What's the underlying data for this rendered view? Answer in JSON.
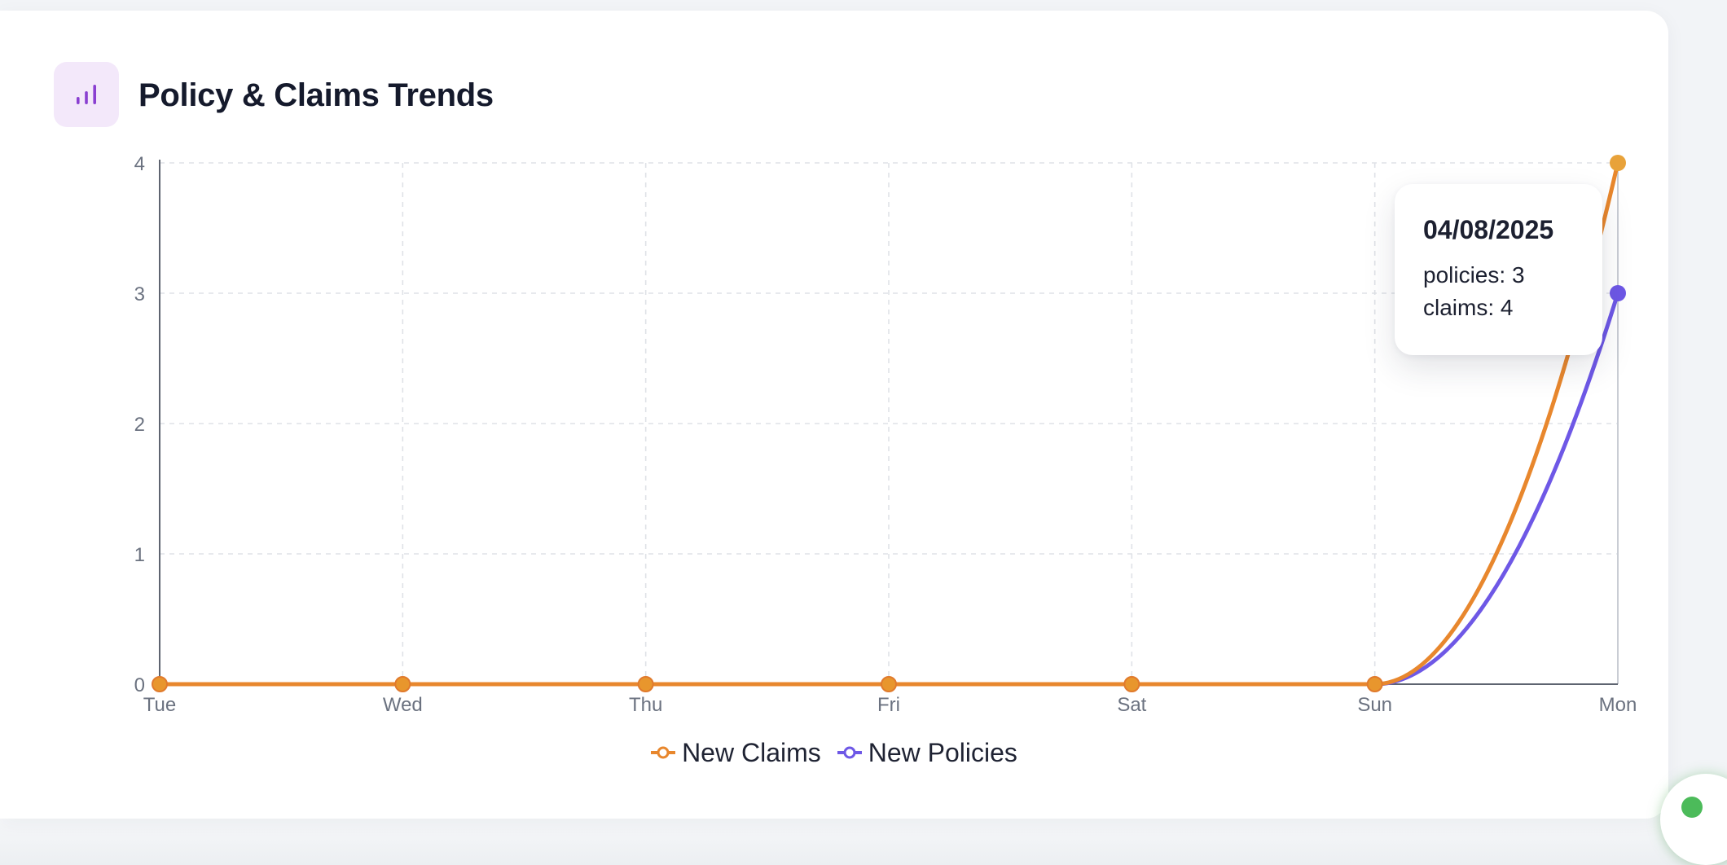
{
  "header": {
    "title": "Policy & Claims Trends",
    "icon": "bar-chart-icon",
    "icon_color": "#8a3fd1"
  },
  "chart_data": {
    "type": "line",
    "title": "Policy & Claims Trends",
    "categories": [
      "Tue",
      "Wed",
      "Thu",
      "Fri",
      "Sat",
      "Sun",
      "Mon"
    ],
    "series": [
      {
        "name": "New Claims",
        "color": "#e8872d",
        "values": [
          0,
          0,
          0,
          0,
          0,
          0,
          4
        ]
      },
      {
        "name": "New Policies",
        "color": "#6e58e6",
        "values": [
          0,
          0,
          0,
          0,
          0,
          0,
          3
        ]
      }
    ],
    "ylim": [
      0,
      4
    ],
    "yticks": [
      "0",
      "1",
      "2",
      "3",
      "4"
    ],
    "grid": true,
    "legend_position": "bottom-center"
  },
  "tooltip": {
    "date": "04/08/2025",
    "policies_text": "policies: 3",
    "claims_text": "claims: 4"
  },
  "status_indicator_color": "#4cbb5a"
}
